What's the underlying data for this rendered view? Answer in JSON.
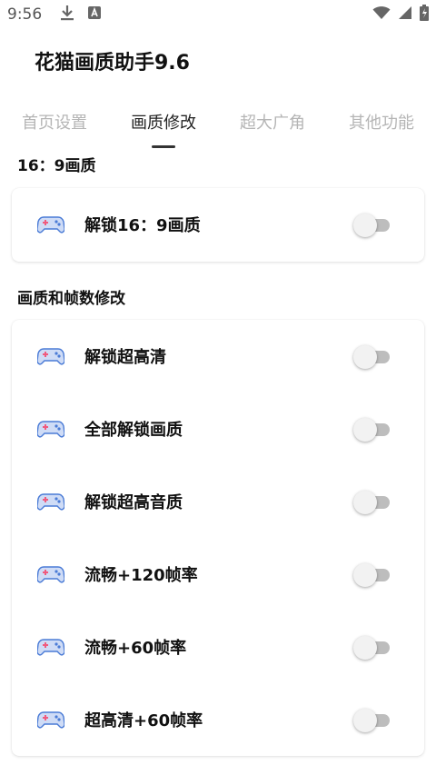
{
  "status_bar": {
    "time": "9:56",
    "icons_left": [
      "download-icon",
      "app-a-icon"
    ],
    "icons_right": [
      "wifi-icon",
      "signal-icon",
      "battery-charging-icon"
    ]
  },
  "app": {
    "title": "花猫画质助手9.6"
  },
  "tabs": [
    {
      "label": "首页设置",
      "active": false
    },
    {
      "label": "画质修改",
      "active": true
    },
    {
      "label": "超大广角",
      "active": false
    },
    {
      "label": "其他功能",
      "active": false
    }
  ],
  "sections": [
    {
      "title": "16：9画质",
      "items": [
        {
          "label": "解锁16：9画质",
          "icon": "gamepad-icon",
          "enabled": false
        }
      ]
    },
    {
      "title": "画质和帧数修改",
      "items": [
        {
          "label": "解锁超高清",
          "icon": "gamepad-icon",
          "enabled": false
        },
        {
          "label": "全部解锁画质",
          "icon": "gamepad-icon",
          "enabled": false
        },
        {
          "label": "解锁超高音质",
          "icon": "gamepad-icon",
          "enabled": false
        },
        {
          "label": "流畅+120帧率",
          "icon": "gamepad-icon",
          "enabled": false
        },
        {
          "label": "流畅+60帧率",
          "icon": "gamepad-icon",
          "enabled": false
        },
        {
          "label": "超高清+60帧率",
          "icon": "gamepad-icon",
          "enabled": false
        }
      ]
    }
  ],
  "colors": {
    "tab_inactive": "#b5b5b5",
    "tab_active": "#222222",
    "switch_track_off": "#bdbdbd",
    "switch_thumb_off": "#f2f2f2",
    "icon_blue": "#4a7bd6",
    "icon_pink": "#f05a7e"
  }
}
